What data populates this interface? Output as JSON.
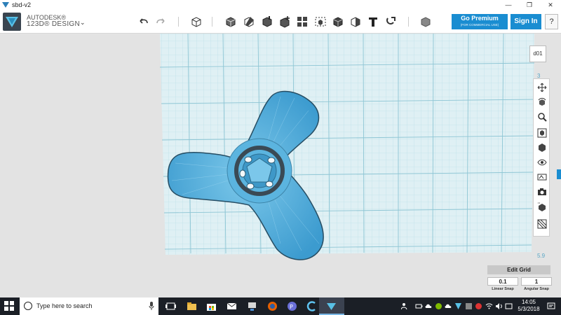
{
  "window": {
    "title": "sbd-v2",
    "controls": [
      "—",
      "❐",
      "✕"
    ]
  },
  "app": {
    "brand_line1": "AUTODESK®",
    "brand_line2": "123D® DESIGN"
  },
  "toolbar": {
    "tools": [
      "undo-icon",
      "redo-icon",
      "new-object-icon",
      "primitives-icon",
      "sketch-icon",
      "construct-icon",
      "modify-icon",
      "pattern-icon",
      "grouping-icon",
      "combine-icon",
      "measure-icon",
      "text-icon",
      "snap-icon",
      "material-icon"
    ],
    "premium_label": "Go Premium",
    "premium_sub": "(FOR COMMERCIAL USE)",
    "signin_label": "Sign In",
    "help_label": "?"
  },
  "viewport": {
    "viewcube_label": "d01",
    "scale_top": "3",
    "scale_bottom": "5.9",
    "model_color": "#4aa8d8"
  },
  "nav_tools": [
    "pan-icon",
    "orbit-icon",
    "zoom-icon",
    "fit-icon",
    "views-icon",
    "visibility-icon",
    "materials-outlines-icon",
    "camera-icon",
    "hide-show-icon",
    "snap-grid-icon"
  ],
  "grid_panel": {
    "title": "Edit Grid",
    "linear_value": "0.1",
    "angular_value": "1",
    "linear_label": "Linear Snap",
    "angular_label": "Angular Snap"
  },
  "taskbar": {
    "search_placeholder": "Type here to search",
    "apps": [
      "task-view-icon",
      "file-explorer-icon",
      "store-icon",
      "mail-icon",
      "network-app-icon",
      "firefox-icon",
      "app-icon",
      "cortana-app-icon",
      "123d-design-icon"
    ],
    "time": "14:05",
    "date": "5/3/2018"
  }
}
